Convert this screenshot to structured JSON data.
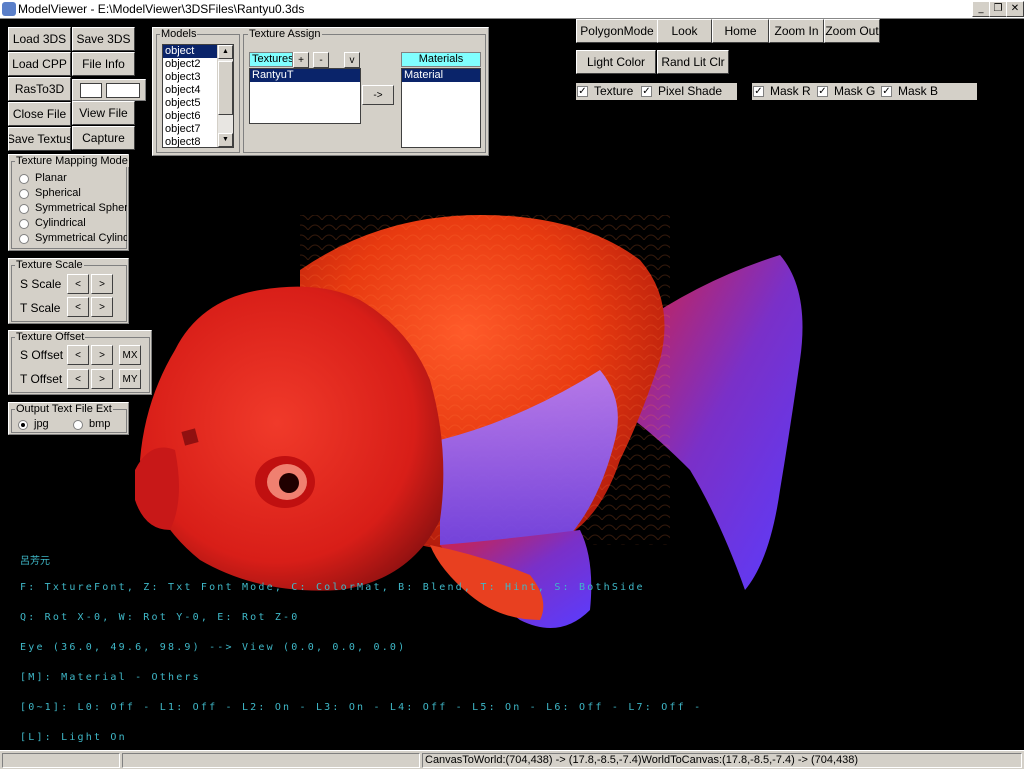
{
  "window": {
    "title": "ModelViewer - E:\\ModelViewer\\3DSFiles\\Rantyu0.3ds",
    "controls": [
      "minimize-icon",
      "restore-icon",
      "close-icon"
    ],
    "control_glyphs": {
      "minimize": "_",
      "restore": "❐",
      "close": "✕"
    }
  },
  "left_buttons": {
    "load_3ds": "Load 3DS",
    "save_3ds": "Save 3DS",
    "load_cpp": "Load CPP",
    "file_info": "File Info",
    "ras_to_3d": "RasTo3D",
    "view_file": "View File",
    "close_file": "Close File",
    "save_texture": "Save Textus",
    "capture": "Capture"
  },
  "models": {
    "label": "Models",
    "items": [
      "object",
      "object2",
      "object3",
      "object4",
      "object5",
      "object6",
      "object7",
      "object8"
    ],
    "selected_index": 0,
    "scroll_up": "▲",
    "scroll_down": "▼"
  },
  "texture_assign": {
    "label": "Texture Assign",
    "textures_header": "Textures",
    "add": "+",
    "remove": "-",
    "dropdown": "v",
    "textures": [
      "RantyuT"
    ],
    "assign_arrow": "->",
    "materials_header": "Materials",
    "materials": [
      "Material"
    ]
  },
  "mapping_mode": {
    "label": "Texture Mapping Mode",
    "options": [
      "Planar",
      "Spherical",
      "Symmetrical Spheric",
      "Cylindrical",
      "Symmetrical Cylindri"
    ],
    "selected": null
  },
  "texture_scale": {
    "label": "Texture Scale",
    "s_label": "S Scale",
    "t_label": "T Scale",
    "dec": "<",
    "inc": ">"
  },
  "texture_offset": {
    "label": "Texture Offset",
    "s_label": "S Offset",
    "t_label": "T Offset",
    "dec": "<",
    "inc": ">",
    "mx": "MX",
    "my": "MY"
  },
  "output_ext": {
    "label": "Output Text File Ext",
    "options": [
      "jpg",
      "bmp"
    ],
    "selected": "jpg"
  },
  "top_toolbar": {
    "polygon_mode": "PolygonMode",
    "look": "Look",
    "home": "Home",
    "zoom_in": "Zoom In",
    "zoom_out": "Zoom Out",
    "light_color": "Light Color",
    "rand_lit_clr": "Rand Lit Clr"
  },
  "checkboxes": {
    "texture": {
      "label": "Texture",
      "checked": true
    },
    "pixel_shade": {
      "label": "Pixel Shade",
      "checked": true
    },
    "mask_r": {
      "label": "Mask R",
      "checked": true
    },
    "mask_g": {
      "label": "Mask G",
      "checked": true
    },
    "mask_b": {
      "label": "Mask B",
      "checked": true
    },
    "check_glyph": "✓"
  },
  "viewport_text": {
    "author": "呂芳元",
    "line1": "F: TxtureFont,  Z: Txt Font Mode,  C: ColorMat,  B: Blend,  T: Hint,  S: BothSide",
    "line2": "Q: Rot X-0,  W: Rot Y-0,  E: Rot Z-0",
    "line3": "Eye (36.0, 49.6, 98.9) --> View (0.0, 0.0, 0.0)",
    "line4": "[M]: Material - Others",
    "line5": "[0~1]: L0: Off - L1: Off - L2: On - L3: On - L4: Off - L5: On - L6: Off - L7: Off -",
    "line6": "[L]: Light On"
  },
  "colors": {
    "viewport_text": "#3fb8c8",
    "selection": "#0a246a",
    "header_cyan": "#80ffff",
    "fish_red": "#e0221c",
    "fish_orange": "#e85a10",
    "fin_blue": "#6a3cff"
  },
  "statusbar": {
    "cell1": "",
    "cell2": "",
    "coords": "CanvasToWorld:(704,438) -> (17.8,-8.5,-7.4)WorldToCanvas:(17.8,-8.5,-7.4) -> (704,438)"
  }
}
